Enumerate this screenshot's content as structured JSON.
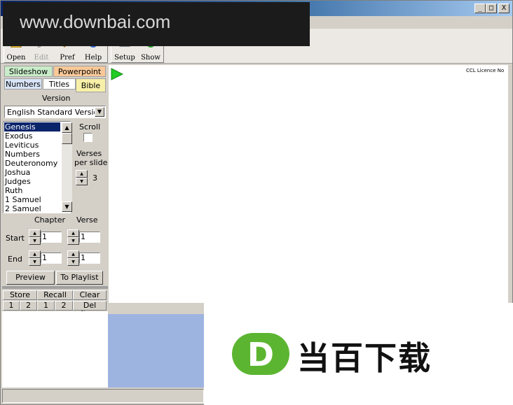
{
  "watermark": {
    "text": "www.downbai.com"
  },
  "window_controls": {
    "minimize": "_",
    "maximize": "□",
    "close": "X"
  },
  "toolbar": {
    "buttons": [
      {
        "label": "Open",
        "icon": "folder-icon",
        "enabled": true
      },
      {
        "label": "Edit",
        "icon": "pencil-icon",
        "enabled": false
      },
      {
        "label": "Pref",
        "icon": "preferences-icon",
        "enabled": true
      },
      {
        "label": "Help",
        "icon": "help-icon",
        "enabled": true
      },
      {
        "label": "Setup",
        "icon": "monitor-icon",
        "enabled": true
      },
      {
        "label": "Show",
        "icon": "play-circle-icon",
        "enabled": true
      }
    ]
  },
  "tabs": {
    "row1": [
      "Slideshow",
      "Powerpoint"
    ],
    "row2": [
      "Numbers",
      "Titles",
      "Bible"
    ]
  },
  "bible": {
    "version_label": "Version",
    "version_value": "English Standard Version",
    "books": [
      "Genesis",
      "Exodus",
      "Leviticus",
      "Numbers",
      "Deuteronomy",
      "Joshua",
      "Judges",
      "Ruth",
      "1 Samuel",
      "2 Samuel"
    ],
    "selected_book": "Genesis",
    "scroll_label": "Scroll",
    "verses_label_1": "Verses",
    "verses_label_2": "per slide",
    "verses_per_slide": "3",
    "chapter_label": "Chapter",
    "verse_label": "Verse",
    "start_label": "Start",
    "end_label": "End",
    "start_chapter": "1",
    "start_verse": "1",
    "end_chapter": "1",
    "end_verse": "1",
    "preview_button": "Preview",
    "playlist_button": "To Playlist"
  },
  "playlist_controls": {
    "row1": [
      "Store",
      "Recall",
      "Clear"
    ],
    "row2": [
      "1",
      "2",
      "1",
      "2",
      "Del Item"
    ]
  },
  "preview": {
    "ccl_text": "CCL Licence No"
  },
  "logo": {
    "letter": "D",
    "text": "当百下载",
    "green": "#5cb531"
  }
}
